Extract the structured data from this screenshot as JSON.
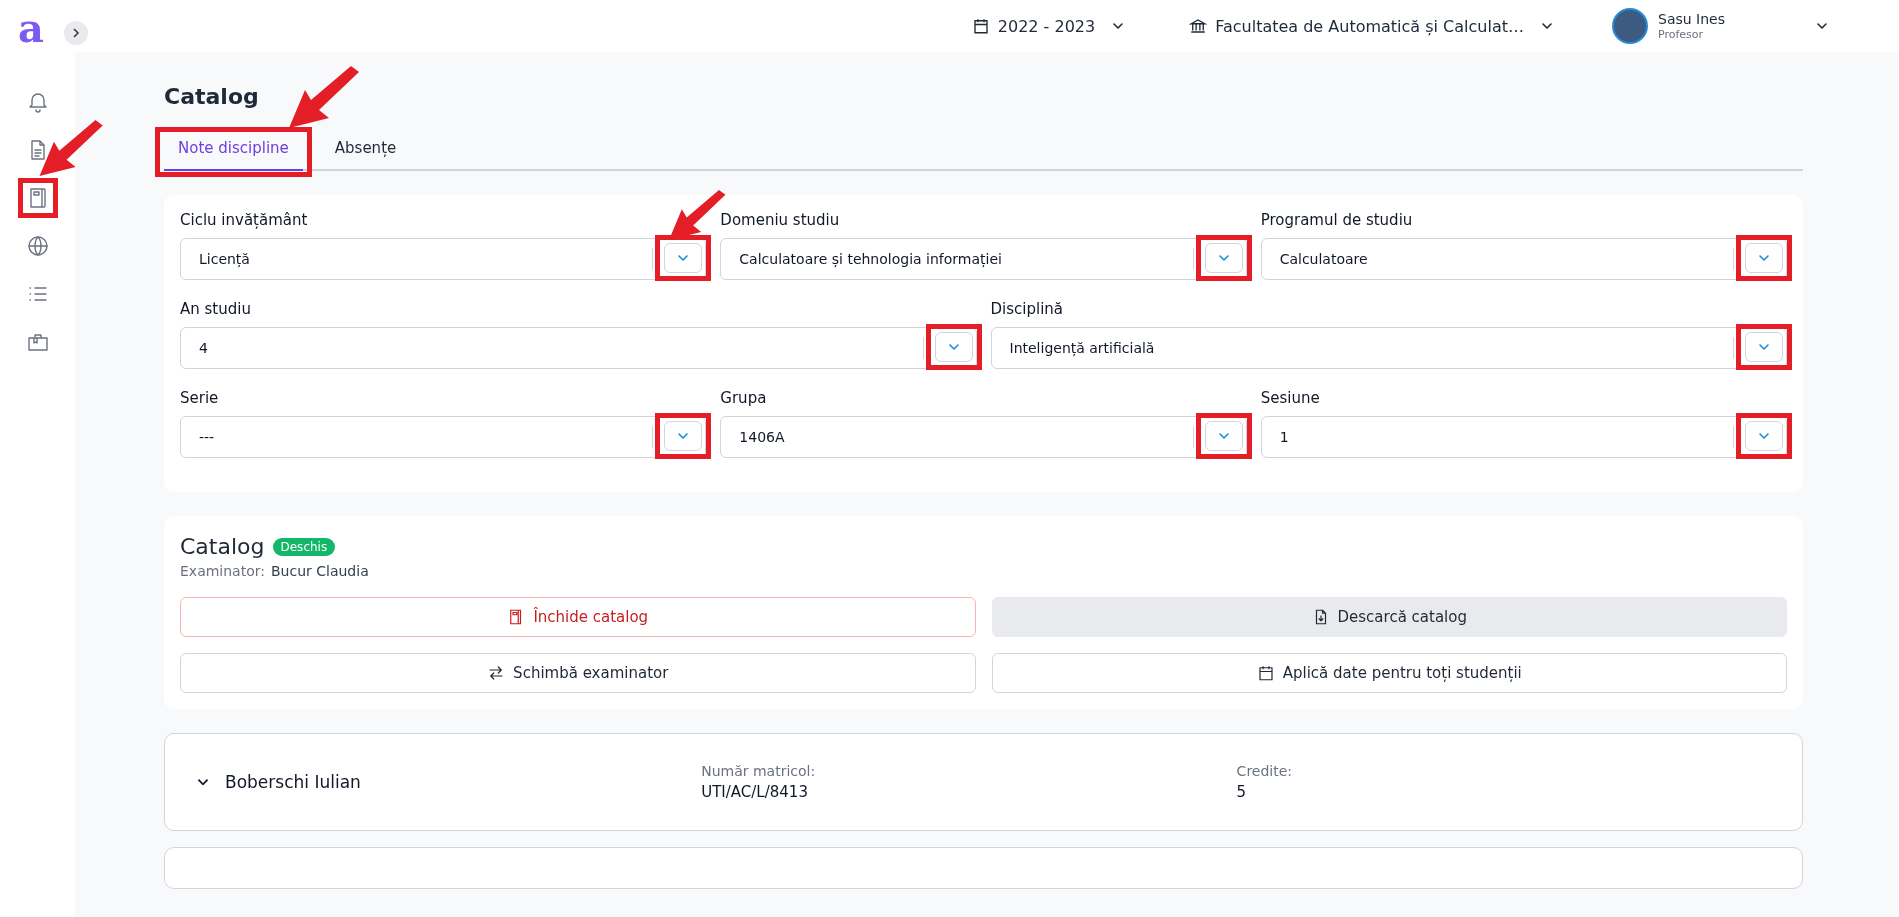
{
  "logo": "a",
  "topbar": {
    "year": "2022 - 2023",
    "faculty": "Facultatea de Automatică și Calculat…",
    "user": {
      "name": "Sasu Ines",
      "role": "Profesor"
    }
  },
  "sidebar": {
    "items": [
      {
        "highlighted": false,
        "arrow": false
      },
      {
        "highlighted": false,
        "arrow": false
      },
      {
        "highlighted": true,
        "arrow": true
      },
      {
        "highlighted": false,
        "arrow": false
      },
      {
        "highlighted": false,
        "arrow": false
      },
      {
        "highlighted": false,
        "arrow": false
      }
    ]
  },
  "page_title": "Catalog",
  "tabs": [
    {
      "label": "Note discipline",
      "selected": true,
      "highlighted": true,
      "arrow": true
    },
    {
      "label": "Absențe",
      "selected": false,
      "highlighted": false,
      "arrow": false
    }
  ],
  "filters": [
    [
      {
        "label": "Ciclu invățământ",
        "value": "Licență",
        "highlighted": true,
        "arrow": true
      },
      {
        "label": "Domeniu studiu",
        "value": "Calculatoare și tehnologia informației",
        "highlighted": true,
        "arrow": false
      },
      {
        "label": "Programul de studiu",
        "value": "Calculatoare",
        "highlighted": true,
        "arrow": false
      }
    ],
    [
      {
        "label": "An studiu",
        "value": "4",
        "highlighted": true,
        "arrow": false
      },
      {
        "label": "Disciplină",
        "value": "Inteligență artificială",
        "highlighted": true,
        "arrow": false
      }
    ],
    [
      {
        "label": "Serie",
        "value": "---",
        "highlighted": true,
        "arrow": false
      },
      {
        "label": "Grupa",
        "value": "1406A",
        "highlighted": true,
        "arrow": false
      },
      {
        "label": "Sesiune",
        "value": "1",
        "highlighted": true,
        "arrow": false
      }
    ]
  ],
  "catalog": {
    "title": "Catalog",
    "status": "Deschis",
    "examiner_label": "Examinator:",
    "examiner": "Bucur Claudia",
    "buttons": [
      {
        "label": "Închide catalog",
        "kind": "danger"
      },
      {
        "label": "Descarcă catalog",
        "kind": "filled"
      },
      {
        "label": "Schimbă examinator",
        "kind": "outline"
      },
      {
        "label": "Aplică date pentru toți studenții",
        "kind": "outline"
      }
    ]
  },
  "students": [
    {
      "name": "Boberschi Iulian",
      "id_label": "Număr matricol:",
      "id": "UTI/AC/L/8413",
      "credits_label": "Credite:",
      "credits": "5",
      "expanded": false
    }
  ]
}
